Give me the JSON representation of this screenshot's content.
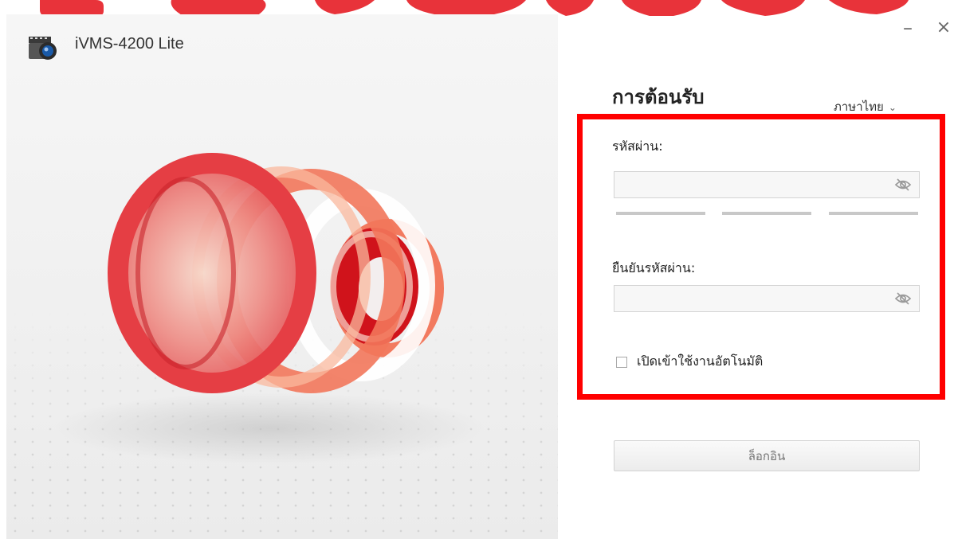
{
  "app": {
    "title": "iVMS-4200 Lite",
    "logo_icon": "camera-icon"
  },
  "window_controls": {
    "minimize": "–",
    "close": "×"
  },
  "form": {
    "title": "การต้อนรับ",
    "language": {
      "selected": "ภาษาไทย",
      "icon": "chevron-down-icon"
    },
    "password": {
      "label": "รหัสผ่าน:",
      "value": "",
      "icon": "eye-off-icon"
    },
    "password_strength": {
      "segments": 3,
      "filled": 0
    },
    "confirm_password": {
      "label": "ยืนยันรหัสผ่าน:",
      "value": "",
      "icon": "eye-off-icon"
    },
    "auto_login": {
      "label": "เปิดเข้าใช้งานอัตโนมัติ",
      "checked": false
    },
    "login_button": "ล็อกอิน"
  },
  "colors": {
    "highlight": "#ff0000",
    "brand_red": "#e8333a"
  }
}
